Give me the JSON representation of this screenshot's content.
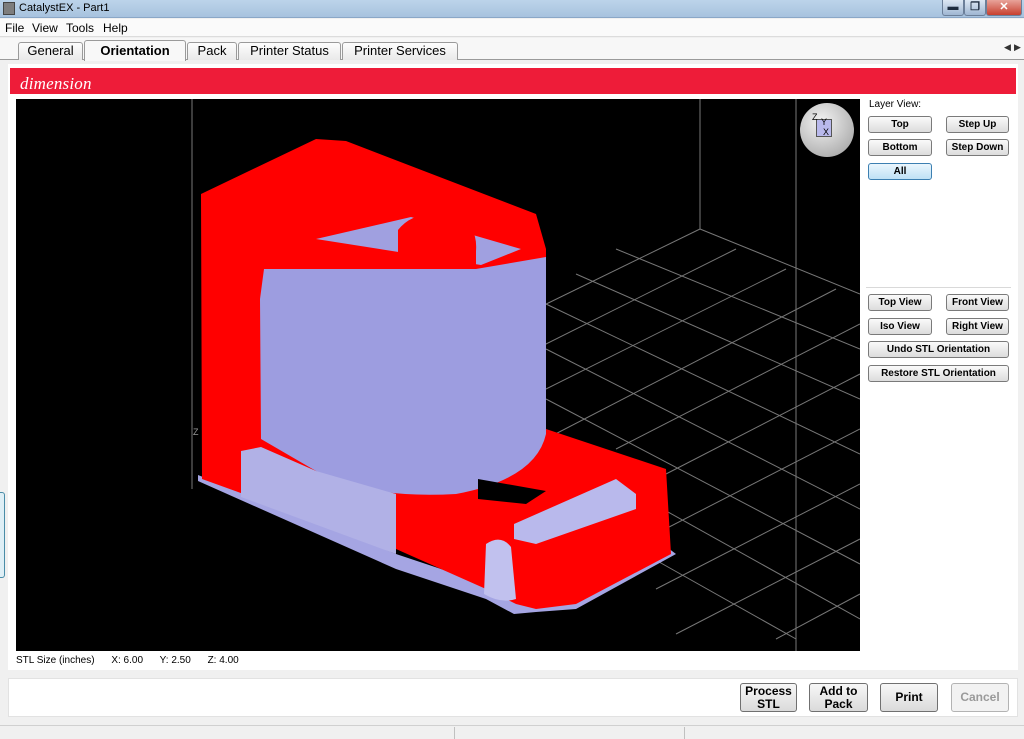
{
  "window": {
    "title": "CatalystEX - Part1",
    "min": "▬",
    "max": "❐",
    "close": "✕"
  },
  "menu": [
    "File",
    "View",
    "Tools",
    "Help"
  ],
  "tabs": [
    {
      "label": "General"
    },
    {
      "label": "Orientation",
      "active": true
    },
    {
      "label": "Pack"
    },
    {
      "label": "Printer Status"
    },
    {
      "label": "Printer Services"
    }
  ],
  "tab_scroll": {
    "left": "◀",
    "right": "▶"
  },
  "brand": {
    "logo_text": "dimension",
    "bar_color": "#ee1c39"
  },
  "viewport": {
    "background": "#000000",
    "model_color": "#ff0000",
    "support_color": "#9999dd",
    "axis_z": "Z",
    "gizmo": {
      "z": "Z",
      "y": "Y",
      "x": "X"
    }
  },
  "layer_view": {
    "label": "Layer View:",
    "top": "Top",
    "step_up": "Step Up",
    "bottom": "Bottom",
    "step_down": "Step Down",
    "all": "All"
  },
  "views": {
    "top_view": "Top View",
    "front_view": "Front View",
    "iso_view": "Iso View",
    "right_view": "Right View",
    "undo": "Undo STL Orientation",
    "restore": "Restore STL Orientation"
  },
  "stl_size": {
    "label": "STL Size (inches)",
    "x": "X: 6.00",
    "y": "Y: 2.50",
    "z": "Z: 4.00"
  },
  "actions": {
    "process_1": "Process",
    "process_2": "STL",
    "add_1": "Add to",
    "add_2": "Pack",
    "print": "Print",
    "cancel": "Cancel"
  }
}
